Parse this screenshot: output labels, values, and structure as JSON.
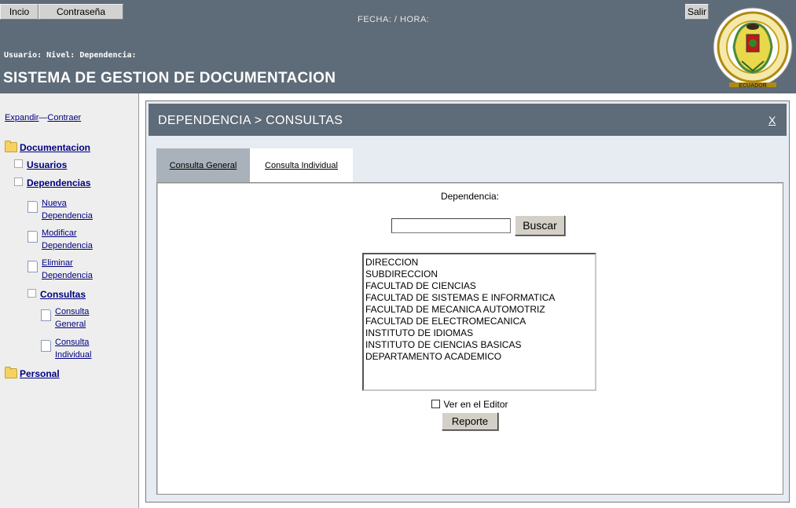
{
  "header": {
    "inicio_label": "Incio",
    "password_label": "Contraseña",
    "salir_label": "Salir",
    "fecha_hora": "FECHA: / HORA:",
    "user_line": "Usuario: Nivel: Dependencia:",
    "app_title": "SISTEMA DE GESTION DE DOCUMENTACION",
    "logo_text": "ESCUELA POLITECNICA DEL EJERCITO",
    "logo_bottom": "ECUADOR"
  },
  "sidebar": {
    "expand": "Expandir",
    "separator": "—",
    "collapse": "Contraer",
    "items": {
      "documentacion": "Documentacion",
      "usuarios": "Usuarios",
      "dependencias": "Dependencias",
      "nueva_1": "Nueva",
      "nueva_2": "Dependencia",
      "modificar_1": "Modificar",
      "modificar_2": "Dependencia",
      "eliminar_1": "Eliminar",
      "eliminar_2": "Dependencia",
      "consultas": "Consultas",
      "c_general_1": "Consulta",
      "c_general_2": "General",
      "c_individual_1": "Consulta",
      "c_individual_2": "Individual",
      "personal": "Personal"
    }
  },
  "main": {
    "title": "DEPENDENCIA > CONSULTAS",
    "close_label": "X",
    "tabs": [
      {
        "label": "Consulta General"
      },
      {
        "label": "Consulta Individual"
      }
    ],
    "dep_label": "Dependencia:",
    "search_value": "",
    "search_button": "Buscar",
    "list_items": [
      "DIRECCION",
      "SUBDIRECCION",
      "FACULTAD DE CIENCIAS",
      "FACULTAD DE SISTEMAS E INFORMATICA",
      "FACULTAD DE MECANICA AUTOMOTRIZ",
      "FACULTAD DE ELECTROMECANICA",
      "INSTITUTO DE IDIOMAS",
      "INSTITUTO DE CIENCIAS BASICAS",
      "DEPARTAMENTO ACADEMICO"
    ],
    "ver_editor_label": "Ver en el Editor",
    "report_button": "Reporte"
  }
}
